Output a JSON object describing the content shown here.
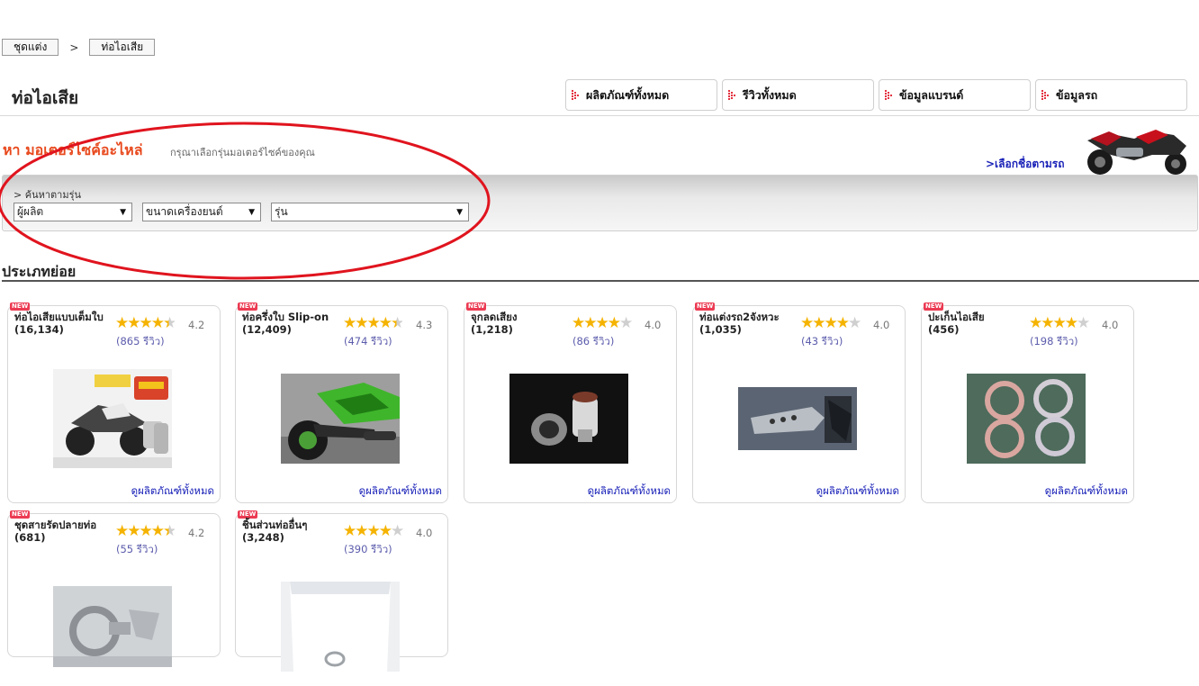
{
  "breadcrumb": [
    "ชุดแต่ง",
    "ท่อไอเสีย"
  ],
  "breadcrumb_separator": ">",
  "page_title": "ท่อไอเสีย",
  "tabs": [
    "ผลิตภัณฑ์ทั้งหมด",
    "รีวิวทั้งหมด",
    "ข้อมูลแบรนด์",
    "ข้อมูลรถ"
  ],
  "finder": {
    "title": "หา มอเตอร์ไซค์อะไหล่",
    "hint": "กรุณาเลือกรุ่นมอเตอร์ไซค์ของคุณ",
    "select_by_bike": ">เลือกชื่อตามรถ",
    "search_label": "> ค้นหาตามรุ่น",
    "selects": [
      "ผู้ผลิต",
      "ขนาดเครื่องยนต์",
      "รุ่น"
    ]
  },
  "section_title": "ประเภทย่อย",
  "new_badge": "NEW",
  "view_all_label": "ดูผลิตภัณฑ์ทั้งหมด",
  "categories": [
    {
      "name": "ท่อไอเสียแบบเต็มใบ",
      "count": "(16,134)",
      "rating": "4.2",
      "stars": 4.5,
      "reviews": "(865 รีวิว)",
      "thumb": "motorcycle-exhaust-photo"
    },
    {
      "name": "ท่อครึ่งใบ Slip-on",
      "count": "(12,409)",
      "rating": "4.3",
      "stars": 4.5,
      "reviews": "(474 รีวิว)",
      "thumb": "green-motorcycle-photo"
    },
    {
      "name": "จุกลดเสียง",
      "count": "(1,218)",
      "rating": "4.0",
      "stars": 4,
      "reviews": "(86 รีวิว)",
      "thumb": "silencer-plug-photo"
    },
    {
      "name": "ท่อแต่งรถ2จังหวะ",
      "count": "(1,035)",
      "rating": "4.0",
      "stars": 4,
      "reviews": "(43 รีวิว)",
      "thumb": "two-stroke-pipe-photo"
    },
    {
      "name": "ปะเก็นไอเสีย",
      "count": "(456)",
      "rating": "4.0",
      "stars": 4,
      "reviews": "(198 รีวิว)",
      "thumb": "exhaust-gasket-photo"
    },
    {
      "name": "ชุดสายรัดปลายท่อ",
      "count": "(681)",
      "rating": "4.2",
      "stars": 4.5,
      "reviews": "(55 รีวิว)",
      "thumb": "exhaust-clamp-photo"
    },
    {
      "name": "ชิ้นส่วนท่ออื่นๆ",
      "count": "(3,248)",
      "rating": "4.0",
      "stars": 4,
      "reviews": "(390 รีวิว)",
      "thumb": "exhaust-wool-photo"
    }
  ],
  "colors": {
    "accent": "#e8491d",
    "link": "#1a22b8",
    "star": "#f5b301",
    "annotation": "#e0141e"
  }
}
